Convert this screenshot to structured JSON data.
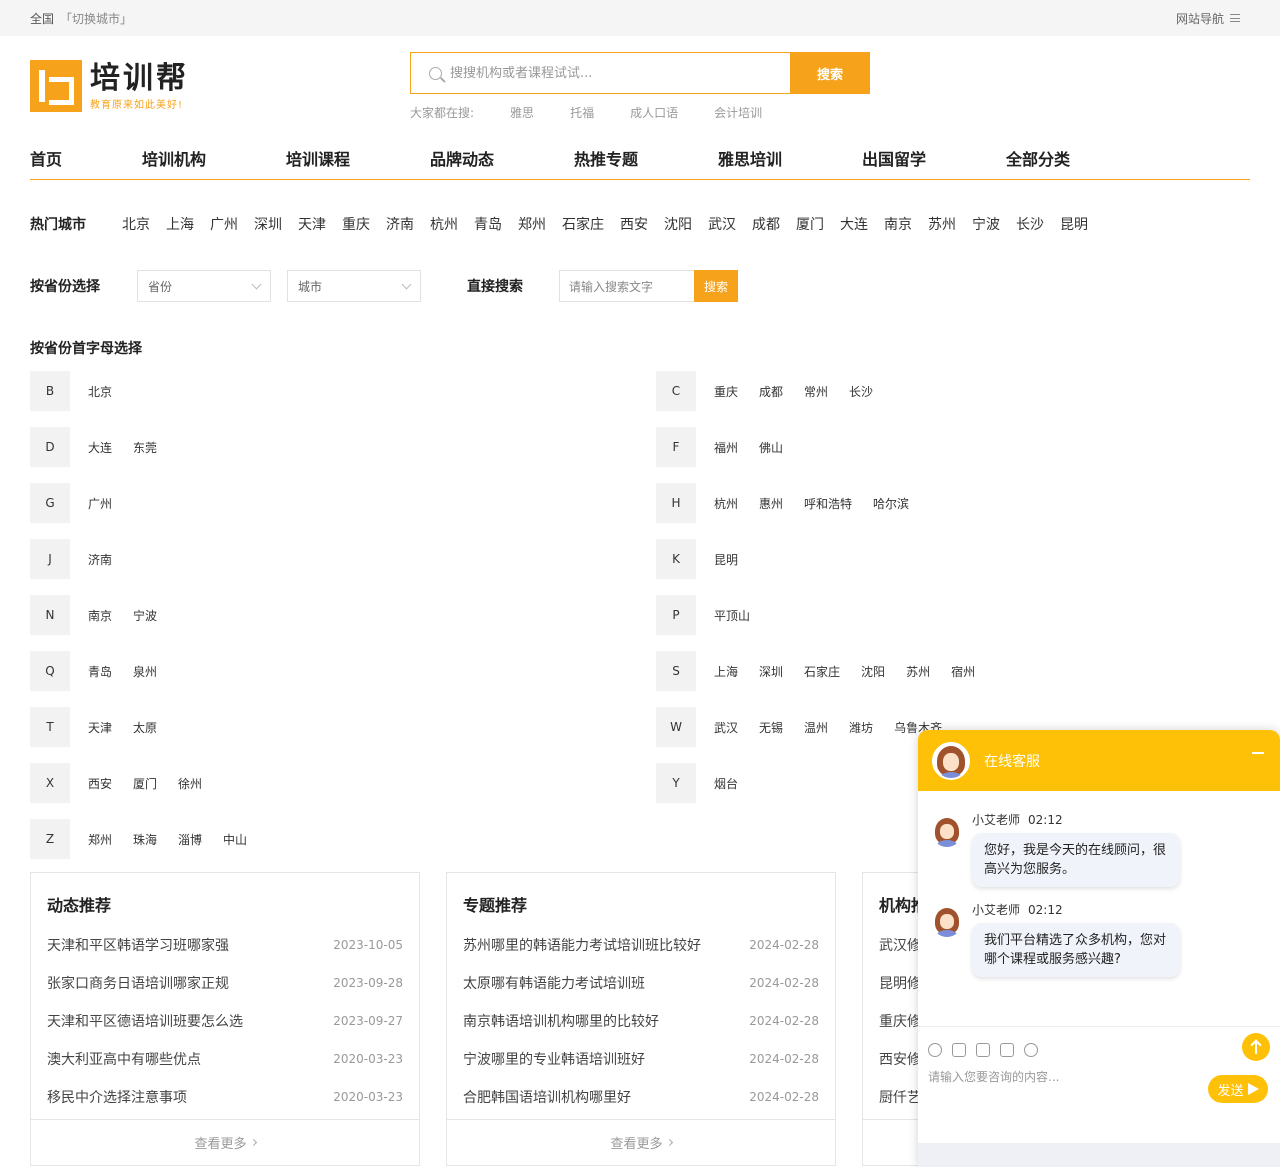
{
  "topbar": {
    "location": "全国",
    "switch_city": "「切换城市」",
    "site_nav": "网站导航"
  },
  "logo": {
    "name": "培训帮",
    "slogan": "教育原来如此美好!"
  },
  "search": {
    "placeholder": "搜搜机构或者课程试试...",
    "button": "搜索",
    "hot_label": "大家都在搜:",
    "hot_keywords": [
      "雅思",
      "托福",
      "成人口语",
      "会计培训"
    ]
  },
  "nav": [
    "首页",
    "培训机构",
    "培训课程",
    "品牌动态",
    "热推专题",
    "雅思培训",
    "出国留学",
    "全部分类"
  ],
  "hot_cities": {
    "label": "热门城市",
    "items": [
      "北京",
      "上海",
      "广州",
      "深圳",
      "天津",
      "重庆",
      "济南",
      "杭州",
      "青岛",
      "郑州",
      "石家庄",
      "西安",
      "沈阳",
      "武汉",
      "成都",
      "厦门",
      "大连",
      "南京",
      "苏州",
      "宁波",
      "长沙",
      "昆明"
    ]
  },
  "province_select": {
    "label": "按省份选择",
    "province_placeholder": "省份",
    "city_placeholder": "城市",
    "direct_label": "直接搜索",
    "direct_placeholder": "请输入搜索文字",
    "direct_button": "搜索"
  },
  "letter_select": {
    "label": "按省份首字母选择",
    "groups": [
      {
        "letter": "B",
        "cities": [
          "北京"
        ]
      },
      {
        "letter": "C",
        "cities": [
          "重庆",
          "成都",
          "常州",
          "长沙"
        ]
      },
      {
        "letter": "D",
        "cities": [
          "大连",
          "东莞"
        ]
      },
      {
        "letter": "F",
        "cities": [
          "福州",
          "佛山"
        ]
      },
      {
        "letter": "G",
        "cities": [
          "广州"
        ]
      },
      {
        "letter": "H",
        "cities": [
          "杭州",
          "惠州",
          "呼和浩特",
          "哈尔滨"
        ]
      },
      {
        "letter": "J",
        "cities": [
          "济南"
        ]
      },
      {
        "letter": "K",
        "cities": [
          "昆明"
        ]
      },
      {
        "letter": "N",
        "cities": [
          "南京",
          "宁波"
        ]
      },
      {
        "letter": "P",
        "cities": [
          "平顶山"
        ]
      },
      {
        "letter": "Q",
        "cities": [
          "青岛",
          "泉州"
        ]
      },
      {
        "letter": "S",
        "cities": [
          "上海",
          "深圳",
          "石家庄",
          "沈阳",
          "苏州",
          "宿州"
        ]
      },
      {
        "letter": "T",
        "cities": [
          "天津",
          "太原"
        ]
      },
      {
        "letter": "W",
        "cities": [
          "武汉",
          "无锡",
          "温州",
          "潍坊",
          "乌鲁木齐"
        ]
      },
      {
        "letter": "X",
        "cities": [
          "西安",
          "厦门",
          "徐州"
        ]
      },
      {
        "letter": "Y",
        "cities": [
          "烟台"
        ]
      },
      {
        "letter": "Z",
        "cities": [
          "郑州",
          "珠海",
          "淄博",
          "中山"
        ]
      }
    ]
  },
  "cards": [
    {
      "title": "动态推荐",
      "more": "查看更多",
      "items": [
        {
          "title": "天津和平区韩语学习班哪家强",
          "date": "2023-10-05"
        },
        {
          "title": "张家口商务日语培训哪家正规",
          "date": "2023-09-28"
        },
        {
          "title": "天津和平区德语培训班要怎么选",
          "date": "2023-09-27"
        },
        {
          "title": "澳大利亚高中有哪些优点",
          "date": "2020-03-23"
        },
        {
          "title": "移民中介选择注意事项",
          "date": "2020-03-23"
        }
      ]
    },
    {
      "title": "专题推荐",
      "more": "查看更多",
      "items": [
        {
          "title": "苏州哪里的韩语能力考试培训班比较好",
          "date": "2024-02-28"
        },
        {
          "title": "太原哪有韩语能力考试培训班",
          "date": "2024-02-28"
        },
        {
          "title": "南京韩语培训机构哪里的比较好",
          "date": "2024-02-28"
        },
        {
          "title": "宁波哪里的专业韩语培训班好",
          "date": "2024-02-28"
        },
        {
          "title": "合肥韩国语培训机构哪里好",
          "date": "2024-02-28"
        }
      ]
    },
    {
      "title": "机构推",
      "more": "",
      "items": [
        {
          "title": "武汉修",
          "date": ""
        },
        {
          "title": "昆明修",
          "date": ""
        },
        {
          "title": "重庆修",
          "date": ""
        },
        {
          "title": "西安修",
          "date": ""
        },
        {
          "title": "厨仟艺",
          "date": ""
        }
      ]
    }
  ],
  "chat": {
    "title": "在线客服",
    "messages": [
      {
        "sender": "小艾老师",
        "time": "02:12",
        "text": "您好，我是今天的在线顾问，很高兴为您服务。"
      },
      {
        "sender": "小艾老师",
        "time": "02:12",
        "text": "我们平台精选了众多机构，您对哪个课程或服务感兴趣?"
      }
    ],
    "input_placeholder": "请输入您要咨询的内容...",
    "send": "发送"
  }
}
